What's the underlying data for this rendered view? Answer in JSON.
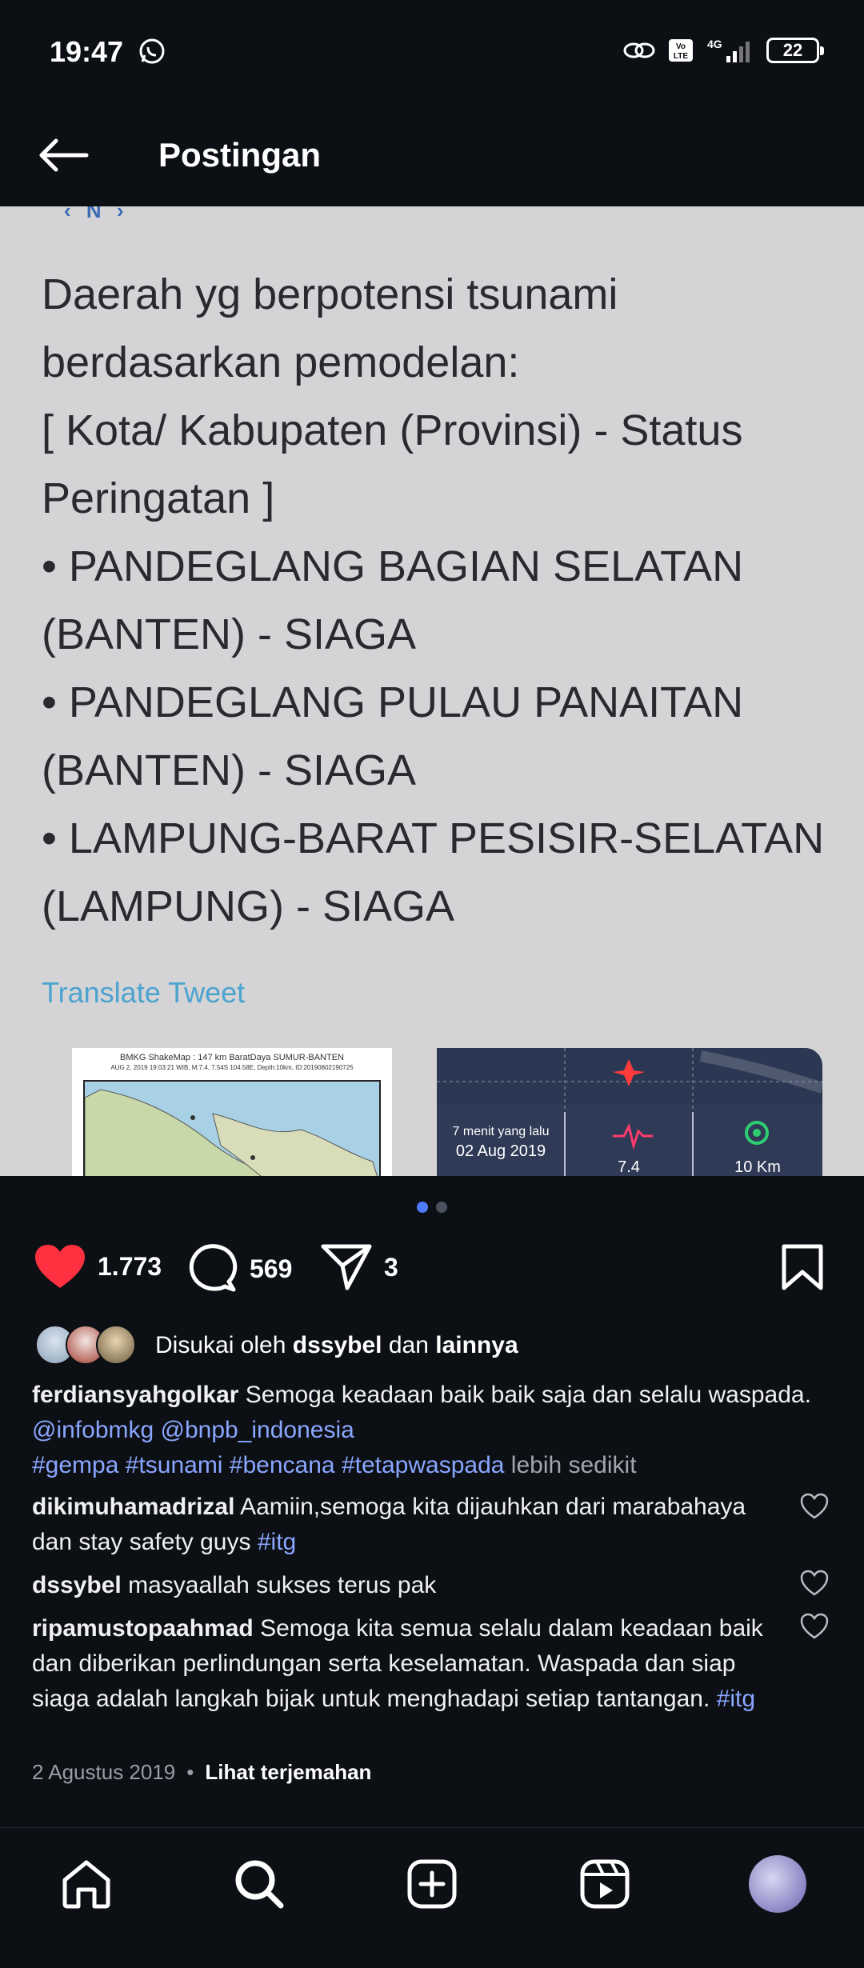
{
  "status_bar": {
    "time": "19:47",
    "battery": "22",
    "icons": [
      "whatsapp-icon",
      "link-icon",
      "volte-icon",
      "4g-signal-icon",
      "battery-icon"
    ]
  },
  "header": {
    "title": "Postingan",
    "back_icon": "arrow-left-icon"
  },
  "post_image": {
    "tweet_cut_text": "‹ N ›",
    "tweet_text": "Daerah yg berpotensi tsunami\nberdasarkan pemodelan:\n[ Kota/ Kabupaten (Provinsi) - Status\nPeringatan ]\n• PANDEGLANG BAGIAN SELATAN\n(BANTEN) - SIAGA\n• PANDEGLANG PULAU PANAITAN\n(BANTEN) - SIAGA\n• LAMPUNG-BARAT PESISIR-SELATAN\n(LAMPUNG) - SIAGA",
    "translate_label": "Translate Tweet",
    "map1_title": "BMKG ShakeMap : 147 km BaratDaya SUMUR-BANTEN",
    "map1_sub": "AUG 2, 2019 19:03:21 WIB, M:7.4, 7.54S 104.58E, Depth:10km, ID:20190802190725",
    "map2_time_ago": "7 menit yang lalu",
    "map2_date": "02 Aug 2019",
    "map2_magnitude": "7.4",
    "map2_depth": "10 Km",
    "page_count": 2,
    "active_page": 1
  },
  "actions": {
    "like_count": "1.773",
    "comment_count": "569",
    "share_count": "3",
    "like_color": "#ff3040"
  },
  "liked_by": {
    "prefix": "Disukai oleh",
    "user": "dssybel",
    "connector": "dan",
    "others": "lainnya"
  },
  "caption": {
    "username": "ferdiansyahgolkar",
    "text": "Semoga keadaan baik baik saja dan selalu waspada.",
    "mentions": "@infobmkg @bnpb_indonesia",
    "hashtags": "#gempa #tsunami #bencana #tetapwaspada",
    "more_label": "lebih sedikit"
  },
  "comments": [
    {
      "username": "dikimuhamadrizal",
      "text": "Aamiin,semoga kita dijauhkan dari marabahaya dan stay safety guys",
      "tag": "#itg"
    },
    {
      "username": "dssybel",
      "text": "masyaallah sukses terus pak",
      "tag": ""
    },
    {
      "username": "ripamustopaahmad",
      "text": "Semoga kita semua selalu dalam keadaan baik dan diberikan perlindungan serta keselamatan. Waspada dan siap siaga adalah langkah bijak untuk menghadapi setiap tantangan.",
      "tag": "#itg"
    }
  ],
  "meta": {
    "date": "2 Agustus 2019",
    "separator": "•",
    "translate_label": "Lihat terjemahan"
  },
  "bottom_nav": [
    "home-icon",
    "search-icon",
    "create-icon",
    "reels-icon",
    "profile-avatar"
  ]
}
